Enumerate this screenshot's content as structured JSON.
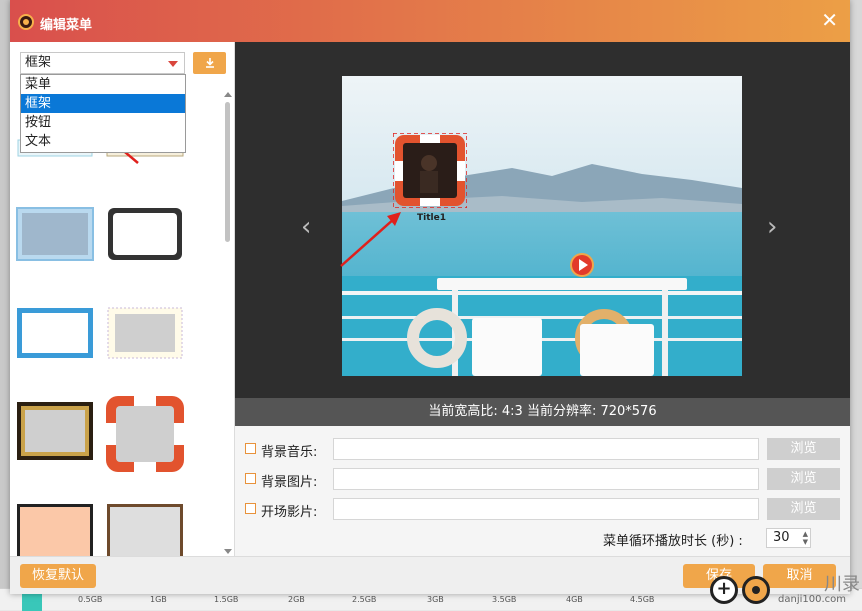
{
  "window": {
    "title": "编辑菜单",
    "close_label": "✕"
  },
  "left_panel": {
    "selected_type": "框架",
    "import_icon": "download-icon",
    "dropdown_options": [
      "菜单",
      "框架",
      "按钮",
      "文本"
    ],
    "dropdown_selected_index": 1
  },
  "preview": {
    "prev_arrow": "‹",
    "next_arrow": "›",
    "frame_title": "Title1"
  },
  "status": {
    "text": "当前宽高比: 4:3 当前分辨率: 720*576"
  },
  "options": {
    "bg_music_label": "背景音乐:",
    "bg_image_label": "背景图片:",
    "intro_video_label": "开场影片:",
    "browse_label": "浏览",
    "loop_label": "菜单循环播放时长 (秒) :",
    "loop_value": "30"
  },
  "footer": {
    "restore_label": "恢复默认",
    "save_label": "保存",
    "cancel_label": "取消"
  },
  "background_app": {
    "storage_ticks": [
      "0.5GB",
      "1GB",
      "1.5GB",
      "2GB",
      "2.5GB",
      "3GB",
      "3.5GB",
      "4GB",
      "4.5GB"
    ]
  },
  "watermark": {
    "site": "danji100.com",
    "glyph": "+",
    "big_text": "川录"
  },
  "colors": {
    "accent": "#f0a64a",
    "title_gradient_start": "#d94f4c",
    "title_gradient_end": "#ec9f46",
    "selection_blue": "#0a78d7",
    "annotation_red": "#e0201c"
  }
}
